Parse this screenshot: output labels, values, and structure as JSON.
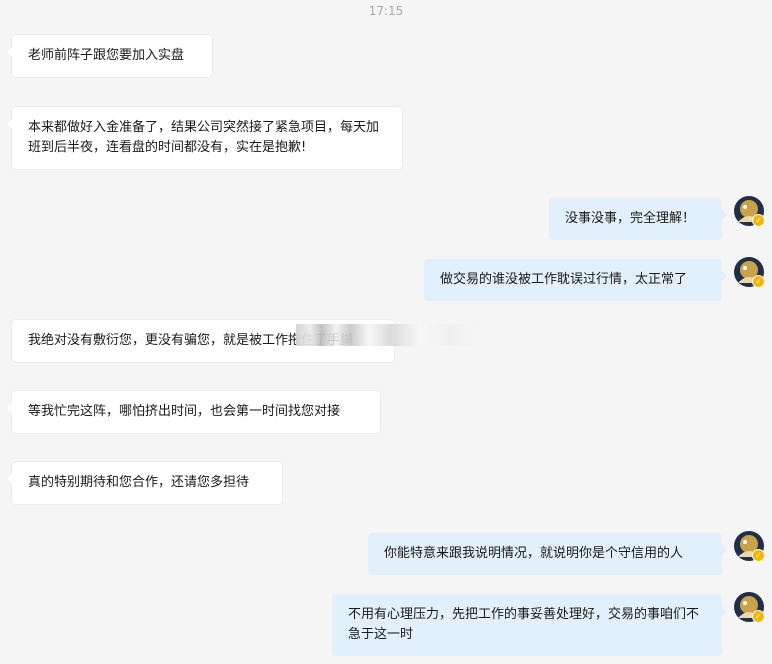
{
  "timestamp": "17:15",
  "messages": [
    {
      "side": "in",
      "text": "老师前阵子跟您要加入实盘"
    },
    {
      "side": "in",
      "text": "本来都做好入金准备了，结果公司突然接了紧急项目，每天加班到后半夜，连看盘的时间都没有，实在是抱歉!"
    },
    {
      "side": "out",
      "text": "没事没事，完全理解！"
    },
    {
      "side": "out",
      "text": "做交易的谁没被工作耽误过行情，太正常了"
    },
    {
      "side": "in",
      "text": "我绝对没有敷衍您，更没有骗您，就是被工作拖住了手脚"
    },
    {
      "side": "in",
      "text": "等我忙完这阵，哪怕挤出时间，也会第一时间找您对接"
    },
    {
      "side": "in",
      "text": "真的特别期待和您合作，还请您多担待"
    },
    {
      "side": "out",
      "text": "你能特意来跟我说明情况，就说明你是个守信用的人"
    },
    {
      "side": "out",
      "text": "不用有心理压力，先把工作的事妥善处理好，交易的事咱们不急于这一时"
    }
  ],
  "avatar_icon": "user-avatar-icon",
  "badge_icon": "verified-badge-icon",
  "colors": {
    "incoming_bubble": "#ffffff",
    "outgoing_bubble": "#e2f0fb",
    "background": "#f5f5f5"
  }
}
